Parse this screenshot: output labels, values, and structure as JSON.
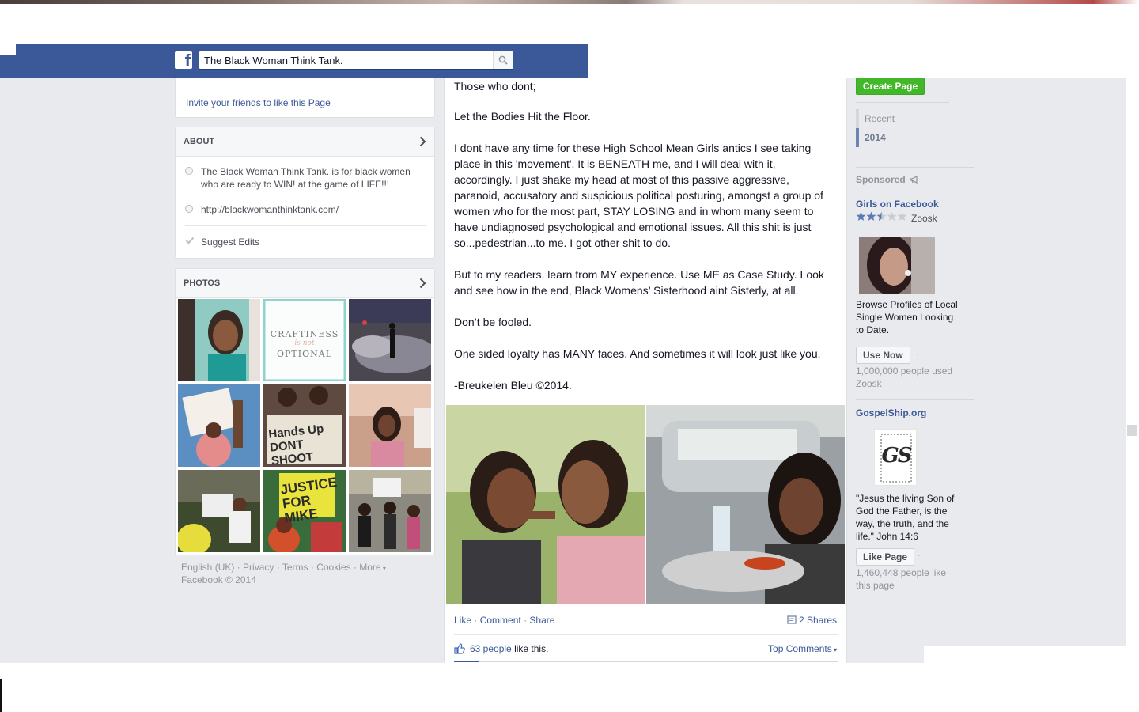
{
  "header": {
    "search_value": "The Black Woman Think Tank."
  },
  "left": {
    "invite_link": "Invite your friends to like this Page",
    "about": {
      "title": "ABOUT",
      "description": "The Black Woman Think Tank. is for black women who are ready to WIN! at the game of LIFE!!!",
      "website": "http://blackwomanthinktank.com/",
      "suggest_edits": "Suggest Edits"
    },
    "photos": {
      "title": "PHOTOS",
      "craftiness_line1": "CRAFTINESS",
      "craftiness_line2": "is not",
      "craftiness_line3": "OPTIONAL",
      "sign_handsup": "Hands Up DONT SHOOT",
      "sign_justice": "JUSTICE FOR MIKE"
    },
    "footer": {
      "english": "English (UK)",
      "privacy": "Privacy",
      "terms": "Terms",
      "cookies": "Cookies",
      "more": "More",
      "copyright": "Facebook © 2014"
    }
  },
  "post": {
    "paragraphs": [
      "Those who dont;",
      "Let the Bodies Hit the Floor.",
      "I dont have any time for these High School Mean Girls antics I see taking place in this 'movement'. It is BENEATH me, and I will deal with it, accordingly. I just shake my head at most of this passive aggressive, paranoid, accusatory and suspicious political posturing, amongst a group of women who for the most part, STAY LOSING and in whom many seem to have undiagnosed psychological and emotional issues. All this shit is just so...pedestrian...to me. I got other shit to do.",
      "But to my readers, learn from MY experience. Use ME as Case Study. Look and see how in the end, Black Womens’ Sisterhood aint Sisterly, at all.",
      "Don’t be fooled.",
      "One sided loyalty has MANY faces. And sometimes it will look just like you.",
      "-Breukelen Bleu ©2014."
    ],
    "actions": {
      "like": "Like",
      "comment": "Comment",
      "share": "Share",
      "shares": "2 Shares"
    },
    "likes": {
      "people": "63 people",
      "suffix": "like this."
    },
    "top_comments": "Top Comments"
  },
  "right": {
    "create_page": "Create Page",
    "years": [
      "Recent",
      "2014"
    ],
    "sponsored": "Sponsored",
    "ad1": {
      "title": "Girls on Facebook",
      "brand": "Zoosk",
      "rating": 2.5,
      "text": "Browse Profiles of Local Single Women Looking to Date.",
      "button": "Use Now",
      "meta": "1,000,000 people used Zoosk"
    },
    "ad2": {
      "title": "GospelShip.org",
      "logo_letters": "GS",
      "text": "\"Jesus the living Son of God the Father, is the way, the truth, and the life.\" John 14:6",
      "button": "Like Page",
      "meta": "1,460,448 people like this page"
    }
  },
  "colors": {
    "header_blue": "#3b5998",
    "link_blue": "#3b5998",
    "create_green": "#42b72a",
    "page_bg": "#e9eaed"
  }
}
